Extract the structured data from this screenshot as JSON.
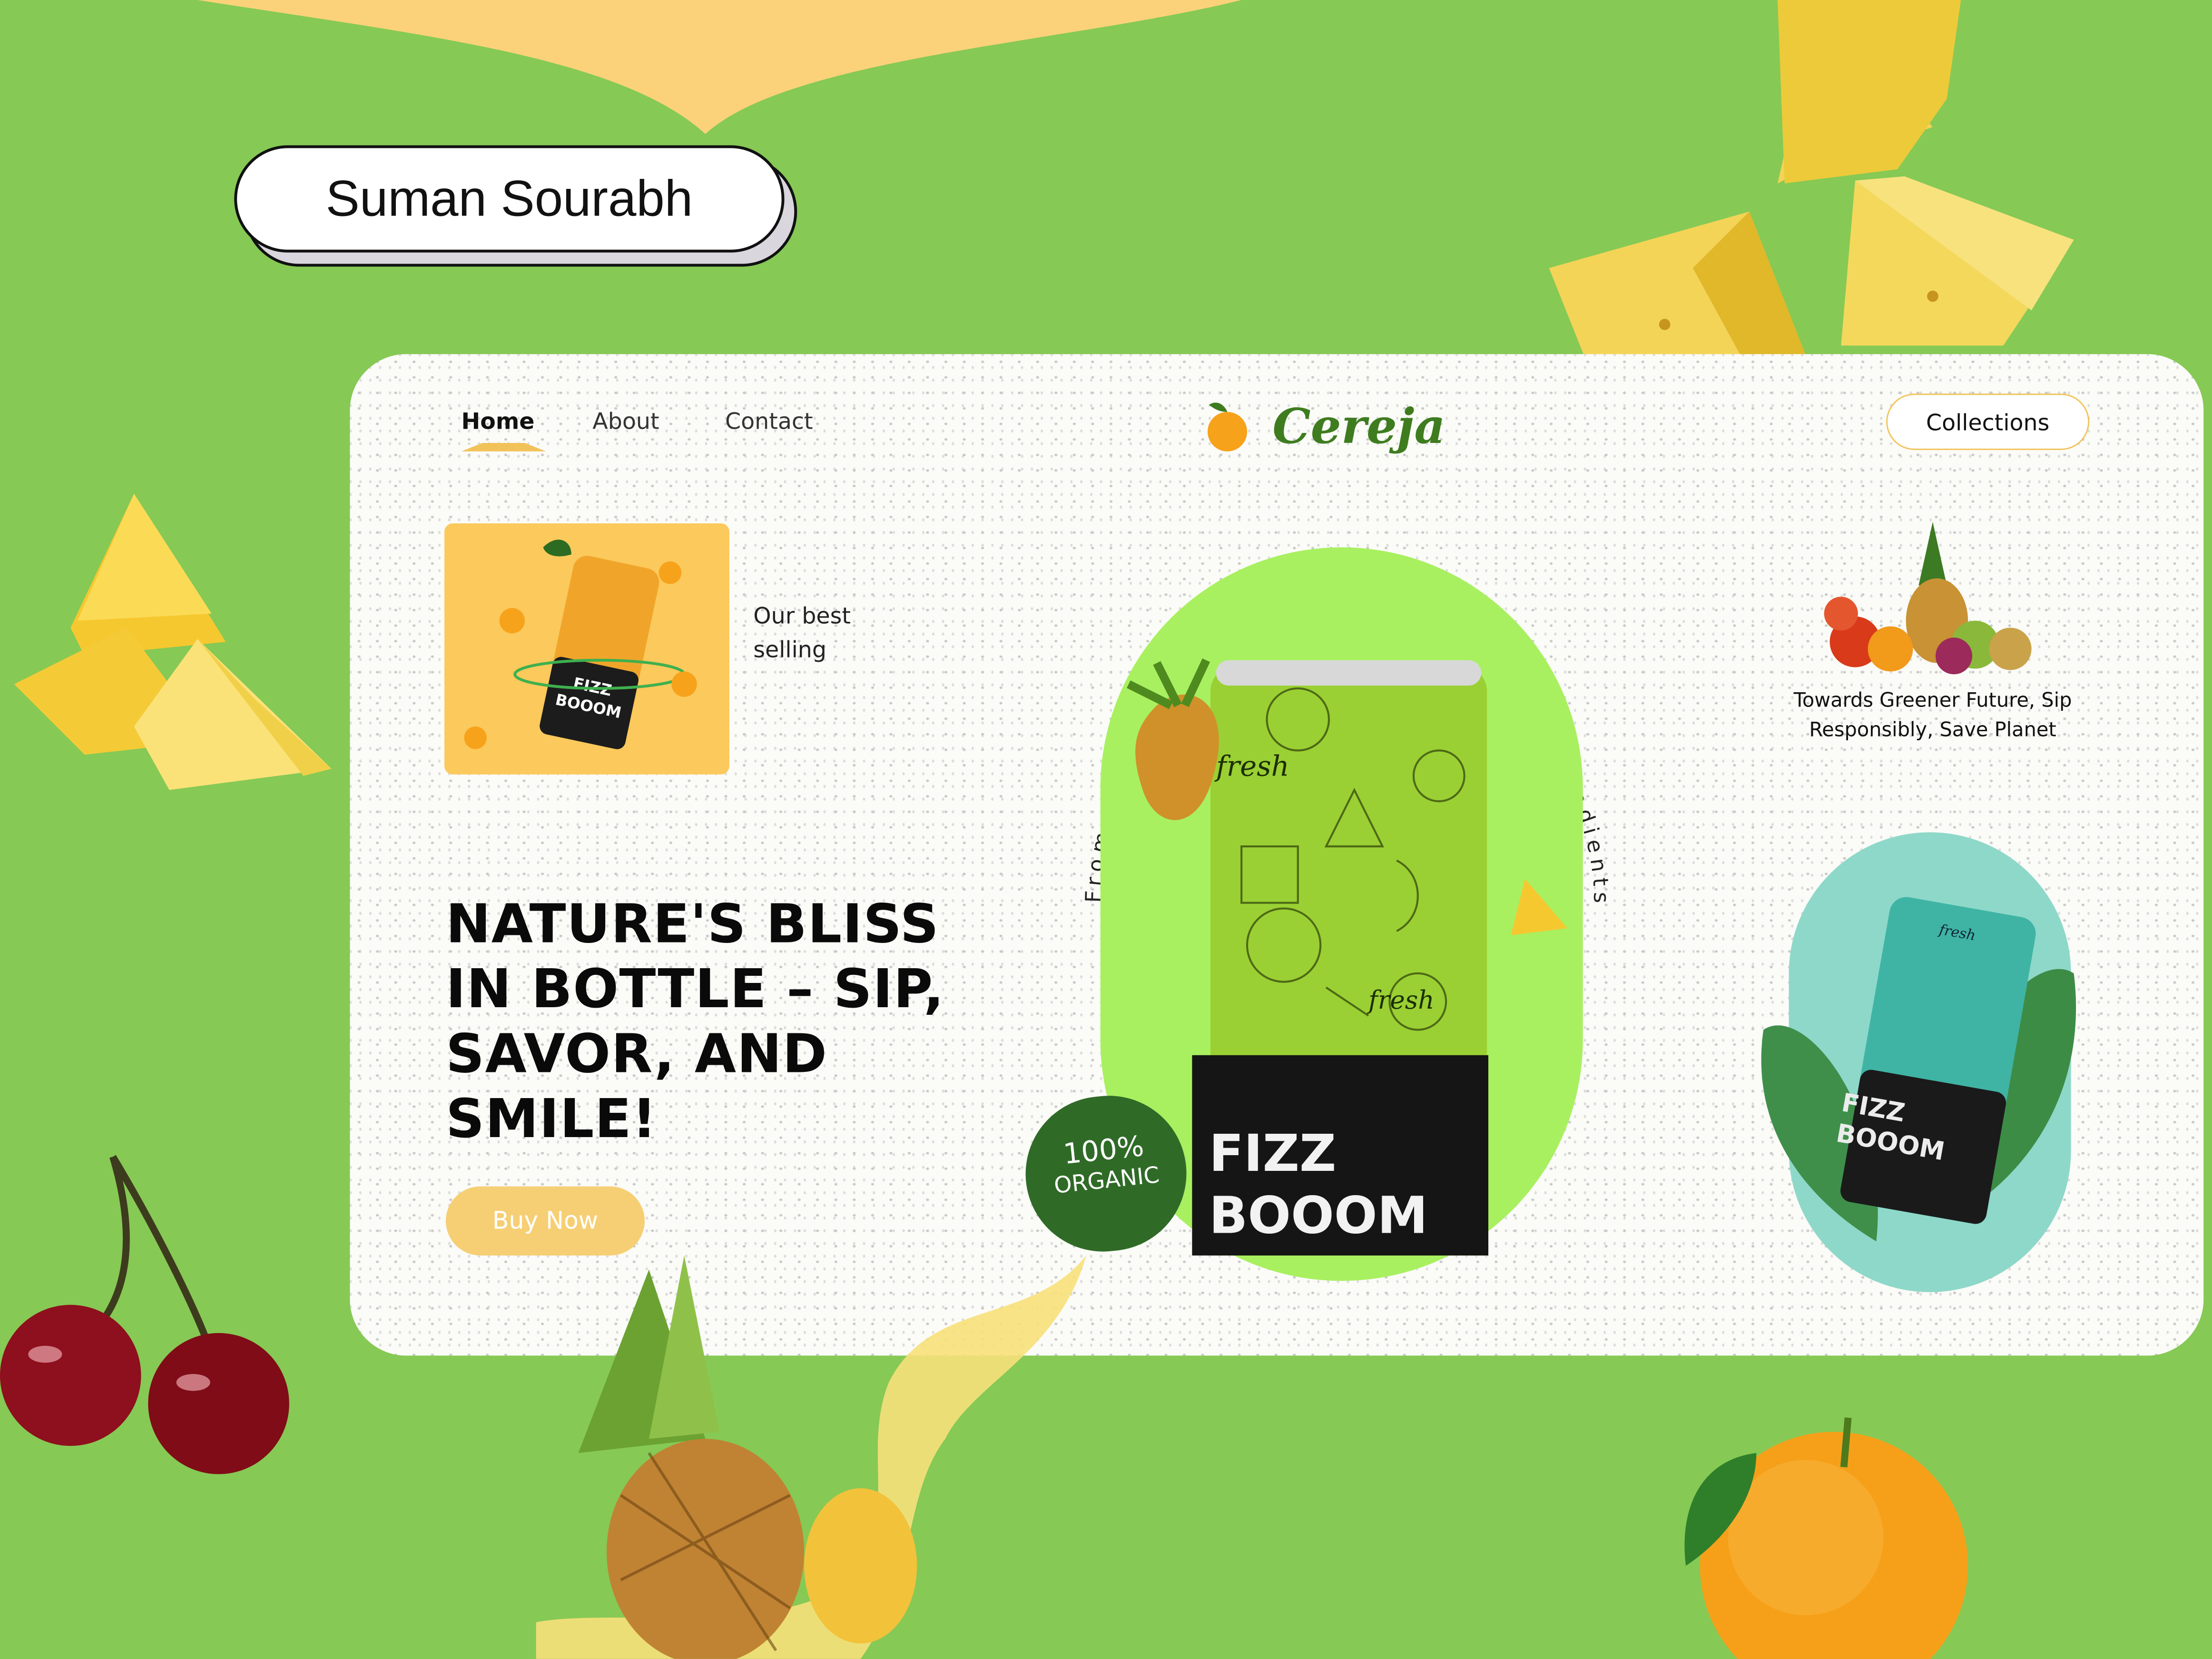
{
  "designer": {
    "name": "Suman Sourabh"
  },
  "nav": {
    "home": "Home",
    "about": "About",
    "contact": "Contact"
  },
  "brand": {
    "name": "Cereja"
  },
  "header": {
    "collections_label": "Collections"
  },
  "best_selling": {
    "label": "Our best selling",
    "can_brand": "FIZZ BOOOM"
  },
  "hero": {
    "headline": "NATURE'S BLISS IN  BOTTLE – SIP, SAVOR, AND SMILE!",
    "buy_label": "Buy Now",
    "circle_text": "From Orchard to Bottle - Only Purest Ingredients Make Cut.",
    "can_tag": "fresh",
    "can_brand_line1": "FIZZ",
    "can_brand_line2": "BOOOM",
    "badge_line1": "100%",
    "badge_line2": "ORGANIC"
  },
  "side": {
    "tagline": "Towards Greener Future, Sip Responsibly, Save  Planet",
    "mint_can_brand_line1": "FIZZ",
    "mint_can_brand_line2": "BOOOM",
    "mint_can_tag": "fresh"
  },
  "colors": {
    "background": "#86c955",
    "card": "#fbfbf7",
    "accent_yellow": "#f6cf75",
    "brand_green": "#3e7c1f",
    "lime_arch": "#a8f060",
    "mint_arch": "#8ed8c9",
    "can_green": "#9ad033",
    "can_mint": "#3fb4a4"
  },
  "icons": [
    "orange-logo-icon",
    "pineapple-icon",
    "cherry-icon",
    "orange-icon",
    "mint-leaf-icon",
    "juice-splash-icon",
    "fruit-pile-icon"
  ]
}
